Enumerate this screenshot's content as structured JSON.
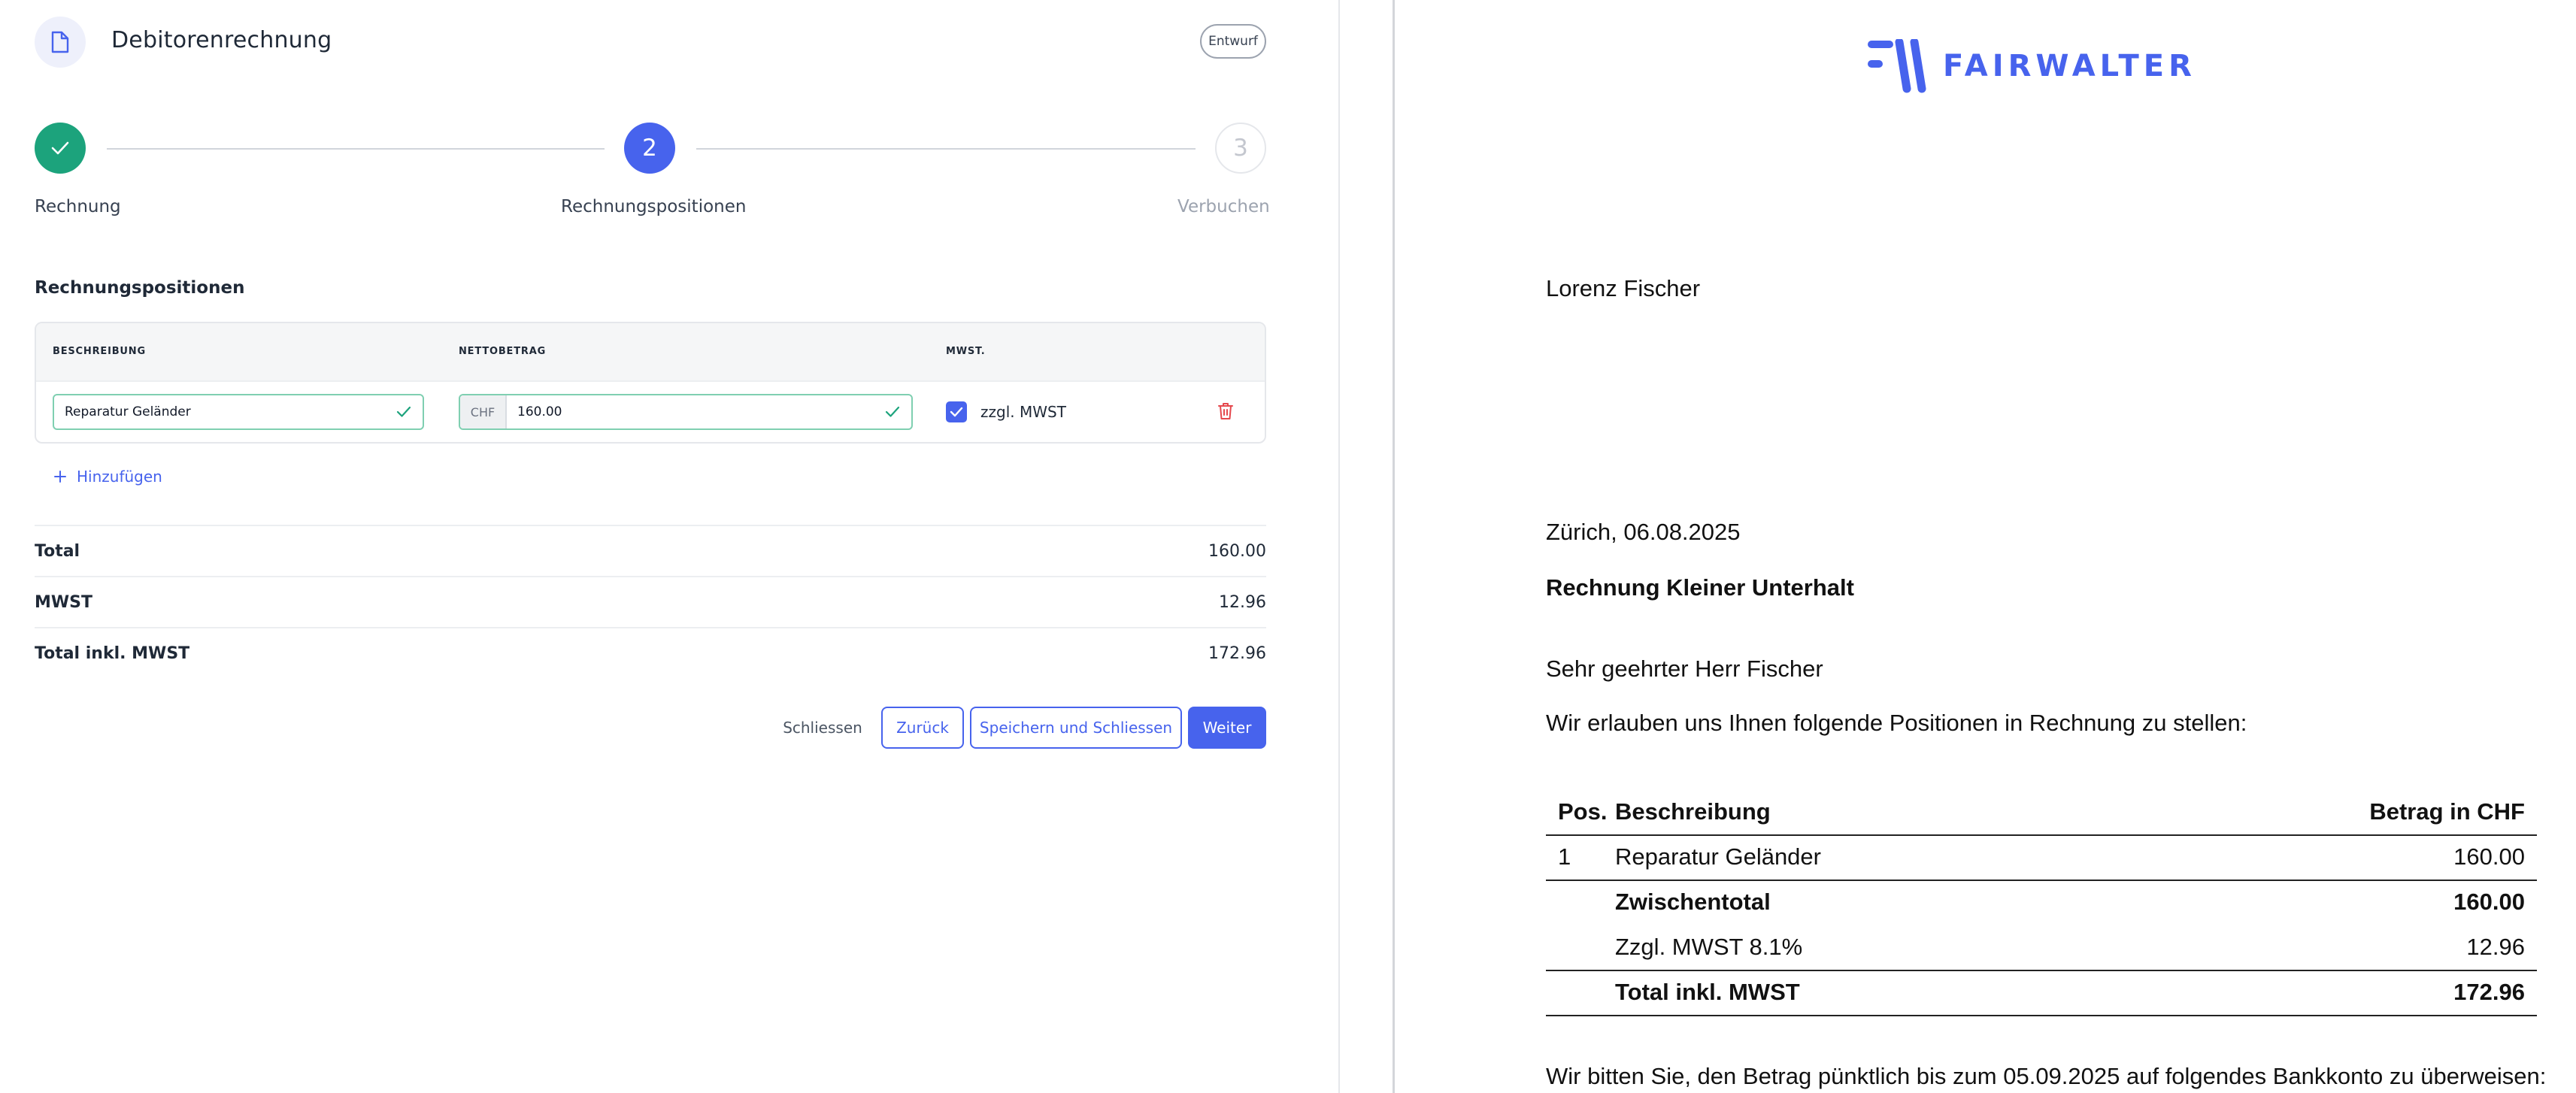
{
  "header": {
    "title": "Debitorenrechnung",
    "status_badge": "Entwurf"
  },
  "stepper": {
    "steps": [
      {
        "number": "1",
        "label": "Rechnung",
        "state": "done"
      },
      {
        "number": "2",
        "label": "Rechnungspositionen",
        "state": "active"
      },
      {
        "number": "3",
        "label": "Verbuchen",
        "state": "pending"
      }
    ]
  },
  "positions": {
    "section_title": "Rechnungspositionen",
    "columns": [
      "BESCHREIBUNG",
      "NETTOBETRAG",
      "MWST."
    ],
    "rows": [
      {
        "description": "Reparatur Geländer",
        "currency": "CHF",
        "amount": "160.00",
        "vat_checked": true,
        "vat_label": "zzgl. MWST"
      }
    ],
    "add_label": "Hinzufügen"
  },
  "summary": [
    {
      "label": "Total",
      "value": "160.00"
    },
    {
      "label": "MWST",
      "value": "12.96"
    },
    {
      "label": "Total inkl. MWST",
      "value": "172.96"
    }
  ],
  "actions": {
    "close": "Schliessen",
    "back": "Zurück",
    "save_close": "Speichern und Schliessen",
    "next": "Weiter"
  },
  "preview": {
    "logo_text": "FAIRWALTER",
    "recipient": "Lorenz Fischer",
    "place_date": "Zürich, 06.08.2025",
    "subject": "Rechnung Kleiner Unterhalt",
    "salutation": "Sehr geehrter Herr Fischer",
    "intro": "Wir erlauben uns Ihnen folgende Positionen in Rechnung zu stellen:",
    "table": {
      "headers": {
        "pos": "Pos.",
        "description": "Beschreibung",
        "amount": "Betrag in CHF"
      },
      "rows": [
        {
          "pos": "1",
          "description": "Reparatur Geländer",
          "amount": "160.00"
        }
      ],
      "subtotal": {
        "label": "Zwischentotal",
        "amount": "160.00"
      },
      "vat": {
        "label": "Zzgl. MWST 8.1%",
        "amount": "12.96"
      },
      "total": {
        "label": "Total inkl. MWST",
        "amount": "172.96"
      }
    },
    "payment_text": "Wir bitten Sie, den Betrag pünktlich bis zum 05.09.2025 auf folgendes Bankkonto zu überweisen:"
  },
  "colors": {
    "primary": "#4763ed",
    "success": "#1ca37c",
    "danger": "#e5484d"
  }
}
